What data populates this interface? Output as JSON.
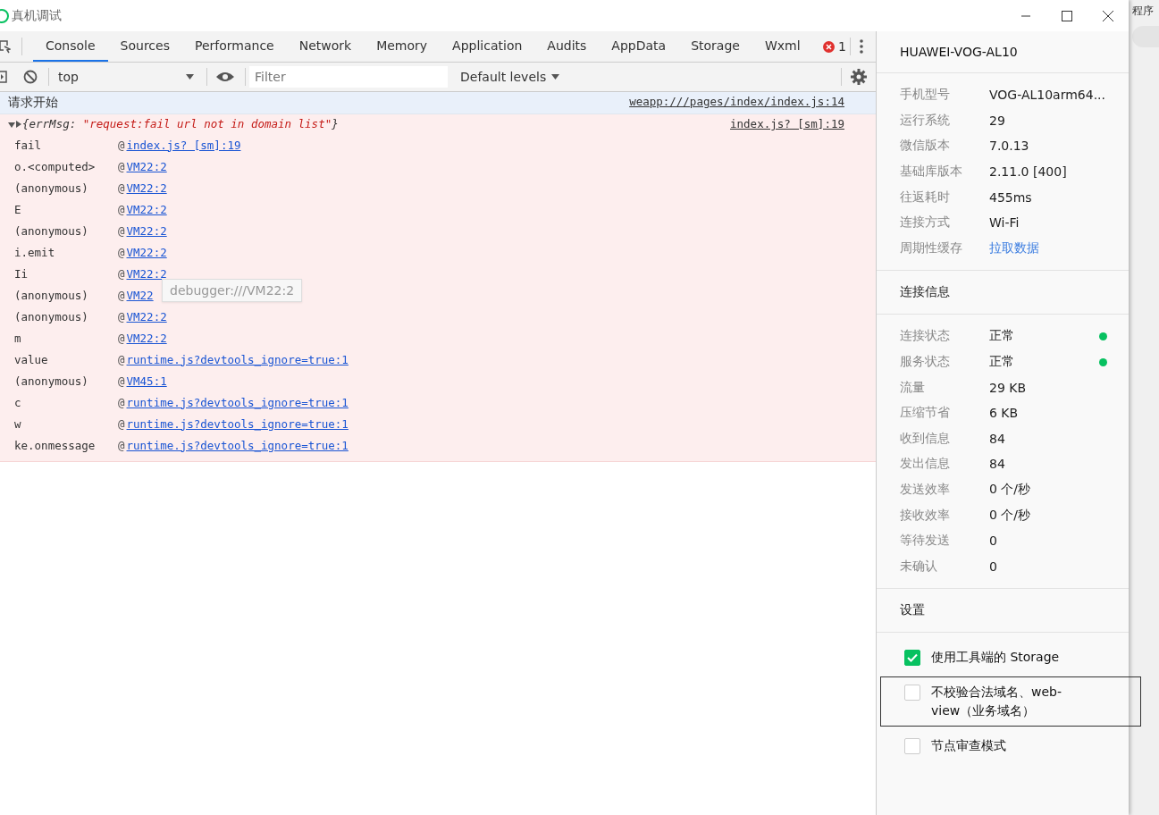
{
  "window": {
    "title": "真机调试"
  },
  "tabs": [
    {
      "label": "Console",
      "selected": true
    },
    {
      "label": "Sources",
      "selected": false
    },
    {
      "label": "Performance",
      "selected": false
    },
    {
      "label": "Network",
      "selected": false
    },
    {
      "label": "Memory",
      "selected": false
    },
    {
      "label": "Application",
      "selected": false
    },
    {
      "label": "Audits",
      "selected": false
    },
    {
      "label": "AppData",
      "selected": false
    },
    {
      "label": "Storage",
      "selected": false
    },
    {
      "label": "Wxml",
      "selected": false
    }
  ],
  "error_count": "1",
  "toolbar": {
    "context": "top",
    "filter_placeholder": "Filter",
    "levels": "Default levels"
  },
  "messages": [
    {
      "kind": "info",
      "text": "请求开始",
      "source": "weapp:///pages/index/index.js:14"
    },
    {
      "kind": "error",
      "expanded": true,
      "preview": [
        {
          "kind": "plain",
          "text": "{errMsg: "
        },
        {
          "kind": "string",
          "text": "\"request:fail url not in domain list\""
        },
        {
          "kind": "plain",
          "text": "}"
        }
      ],
      "source": "index.js? [sm]:19",
      "stack": [
        {
          "fn": "fail",
          "at": "@",
          "link": "index.js? [sm]:19"
        },
        {
          "fn": "o.<computed>",
          "at": "@",
          "link": "VM22:2"
        },
        {
          "fn": "(anonymous)",
          "at": "@",
          "link": "VM22:2"
        },
        {
          "fn": "E",
          "at": "@",
          "link": "VM22:2"
        },
        {
          "fn": "(anonymous)",
          "at": "@",
          "link": "VM22:2"
        },
        {
          "fn": "i.emit",
          "at": "@",
          "link": "VM22:2"
        },
        {
          "fn": "Ii",
          "at": "@",
          "link": "VM22:2"
        },
        {
          "fn": "(anonymous)",
          "at": "@",
          "link": "VM22"
        },
        {
          "fn": "(anonymous)",
          "at": "@",
          "link": "VM22:2"
        },
        {
          "fn": "m",
          "at": "@",
          "link": "VM22:2"
        },
        {
          "fn": "value",
          "at": "@",
          "link": "runtime.js?devtools_ignore=true:1"
        },
        {
          "fn": "(anonymous)",
          "at": "@",
          "link": "VM45:1"
        },
        {
          "fn": "c",
          "at": "@",
          "link": "runtime.js?devtools_ignore=true:1"
        },
        {
          "fn": "w",
          "at": "@",
          "link": "runtime.js?devtools_ignore=true:1"
        },
        {
          "fn": "ke.onmessage",
          "at": "@",
          "link": "runtime.js?devtools_ignore=true:1"
        }
      ]
    }
  ],
  "tooltip": "debugger:///VM22:2",
  "device_panel": {
    "title": "HUAWEI-VOG-AL10",
    "info": [
      {
        "label": "手机型号",
        "value": "VOG-AL10arm64...",
        "kind": "text"
      },
      {
        "label": "运行系统",
        "value": "29",
        "kind": "text"
      },
      {
        "label": "微信版本",
        "value": "7.0.13",
        "kind": "text"
      },
      {
        "label": "基础库版本",
        "value": "2.11.0 [400]",
        "kind": "text"
      },
      {
        "label": "往返耗时",
        "value": "455ms",
        "kind": "text"
      },
      {
        "label": "连接方式",
        "value": "Wi-Fi",
        "kind": "text"
      },
      {
        "label": "周期性缓存",
        "value": "拉取数据",
        "kind": "link"
      }
    ],
    "connection": {
      "title": "连接信息",
      "rows": [
        {
          "label": "连接状态",
          "value": "正常",
          "color": "#07c160"
        },
        {
          "label": "服务状态",
          "value": "正常",
          "color": "#07c160"
        },
        {
          "label": "流量",
          "value": "29 KB"
        },
        {
          "label": "压缩节省",
          "value": "6 KB"
        },
        {
          "label": "收到信息",
          "value": "84"
        },
        {
          "label": "发出信息",
          "value": "84"
        },
        {
          "label": "发送效率",
          "value": "0 个/秒"
        },
        {
          "label": "接收效率",
          "value": "0 个/秒"
        },
        {
          "label": "等待发送",
          "value": "0"
        },
        {
          "label": "未确认",
          "value": "0"
        }
      ]
    },
    "settings": {
      "title": "设置",
      "options": [
        {
          "label": "使用工具端的 Storage",
          "checked": true,
          "highlighted": false
        },
        {
          "label": "不校验合法域名、web-view（业务域名）",
          "checked": false,
          "highlighted": true
        },
        {
          "label": "节点审查模式",
          "checked": false,
          "highlighted": false
        }
      ]
    }
  },
  "background_window": {
    "text": "程序"
  }
}
